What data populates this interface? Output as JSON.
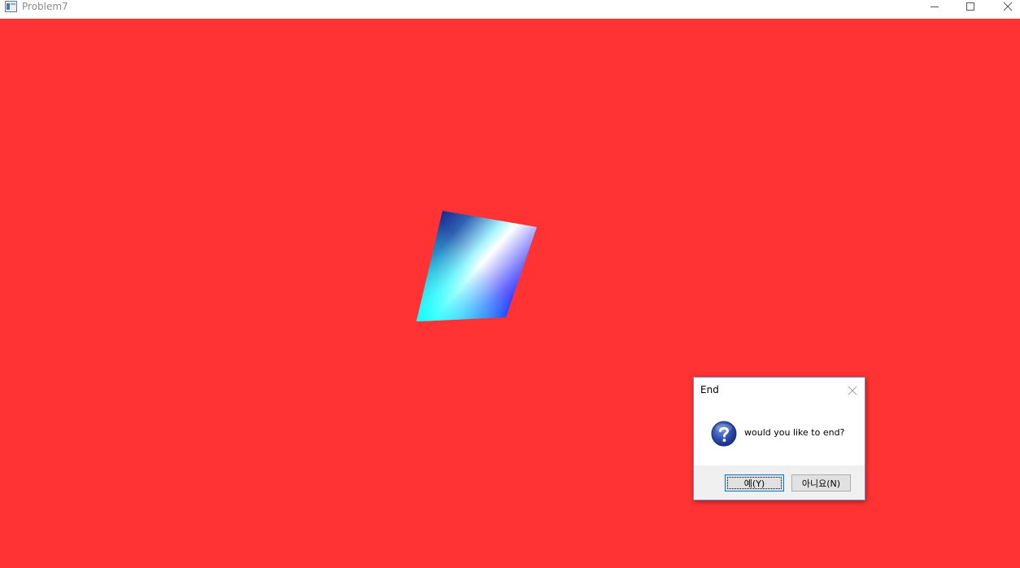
{
  "window": {
    "title": "Problem7",
    "background_color": "#ff3333"
  },
  "title_buttons": {
    "minimize_icon": "minimize-icon",
    "maximize_icon": "maximize-icon",
    "close_icon": "close-icon"
  },
  "scene": {
    "shape": "gradient-quad",
    "colors": [
      "#00007a",
      "#40ffff",
      "#0000ff",
      "#ffffff"
    ]
  },
  "dialog": {
    "title": "End",
    "icon": "question-icon",
    "message": "would you like to end?",
    "yes_label": "예(Y)",
    "no_label": "아니요(N)"
  }
}
